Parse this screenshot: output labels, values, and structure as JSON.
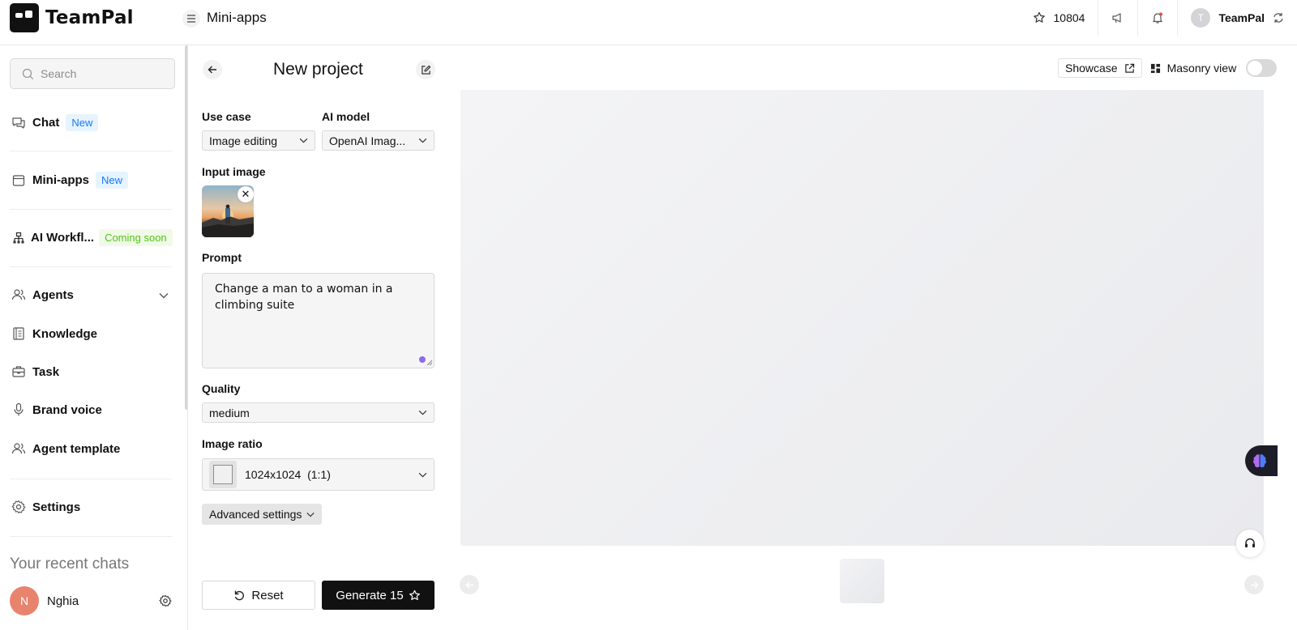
{
  "app": {
    "name": "TeamPal"
  },
  "header": {
    "page_title": "Mini-apps",
    "stars_count": "10804",
    "user_initial": "T",
    "user_name": "TeamPal"
  },
  "sidebar": {
    "search_placeholder": "Search",
    "items": [
      {
        "label": "Chat",
        "badge": "New",
        "icon": "chat-icon"
      },
      {
        "label": "Mini-apps",
        "badge": "New",
        "icon": "window-icon"
      },
      {
        "label": "AI Workfl...",
        "badge": "Coming soon",
        "icon": "workflow-icon"
      },
      {
        "label": "Agents",
        "icon": "users-icon"
      },
      {
        "label": "Knowledge",
        "icon": "book-icon"
      },
      {
        "label": "Task",
        "icon": "briefcase-icon"
      },
      {
        "label": "Brand voice",
        "icon": "microphone-icon"
      },
      {
        "label": "Agent template",
        "icon": "users-icon"
      },
      {
        "label": "Settings",
        "icon": "gear-icon"
      }
    ],
    "recent_heading": "Your recent chats",
    "user": {
      "initial": "N",
      "name": "Nghia"
    }
  },
  "panel": {
    "title": "New project",
    "use_case_label": "Use case",
    "use_case_value": "Image editing",
    "ai_model_label": "AI model",
    "ai_model_value": "OpenAI Imag...",
    "input_image_label": "Input image",
    "prompt_label": "Prompt",
    "prompt_value": "Change a man to a woman in a climbing suite",
    "quality_label": "Quality",
    "quality_value": "medium",
    "image_ratio_label": "Image ratio",
    "image_ratio_value": "1024x1024  (1:1)",
    "advanced_label": "Advanced settings",
    "reset_label": "Reset",
    "generate_label": "Generate 15"
  },
  "preview": {
    "showcase_label": "Showcase",
    "masonry_label": "Masonry view",
    "masonry_enabled": false
  },
  "colors": {
    "accent_blue": "#1677ff",
    "badge_green": "#52c41a",
    "primary_button": "#111111",
    "user_avatar": "#e8846e"
  }
}
